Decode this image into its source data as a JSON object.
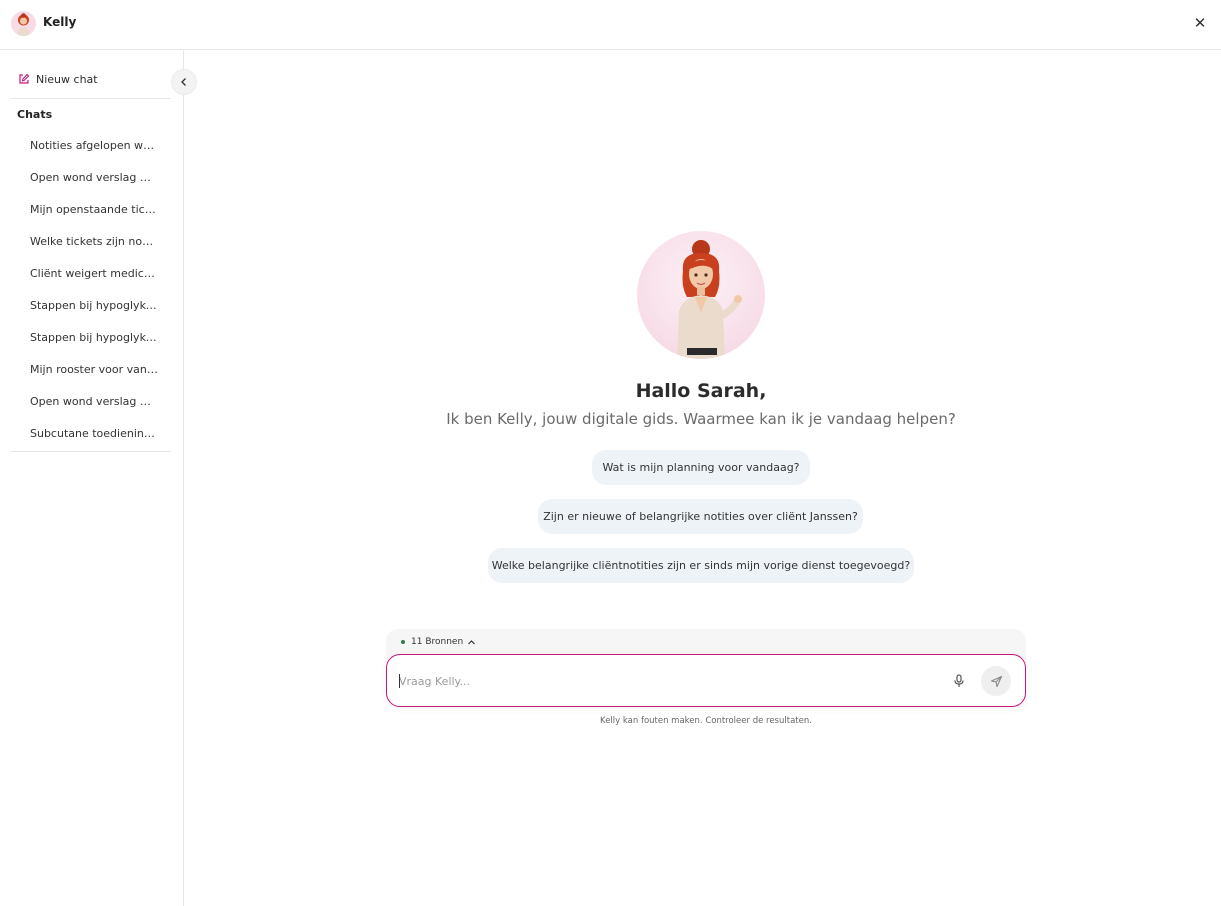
{
  "header": {
    "title": "Kelly",
    "close_glyph": "✕"
  },
  "sidebar": {
    "new_chat_label": "Nieuw chat",
    "chats_heading": "Chats",
    "chats": [
      "Notities afgelopen weekend",
      "Open wond verslag Mevrouw",
      "Mijn openstaande tickets",
      "Welke tickets zijn nog open",
      "Cliënt weigert medicatie",
      "Stappen bij hypoglykemie",
      "Stappen bij hypoglykemie",
      "Mijn rooster voor vandaag",
      "Open wond verslag Mevrouw",
      "Subcutane toediening insuline"
    ]
  },
  "main": {
    "greeting": "Hallo Sarah,",
    "subtitle": "Ik ben Kelly, jouw digitale gids. Waarmee kan ik je vandaag helpen?",
    "suggestions": [
      "Wat is mijn planning voor vandaag?",
      "Zijn er nieuwe of belangrijke notities over cliënt Janssen?",
      "Welke belangrijke cliëntnotities zijn er sinds mijn vorige dienst toegevoegd?"
    ],
    "sources_label": "11 Bronnen",
    "input_placeholder": "Vraag Kelly...",
    "disclaimer": "Kelly kan fouten maken. Controleer de resultaten."
  },
  "colors": {
    "accent": "#c4197a",
    "suggestion_bg": "#eef3f8",
    "avatar_bg": "#f7dde8",
    "status_dot": "#2e7d4f"
  },
  "icons": {
    "new_chat": "edit-icon",
    "collapse": "chevron-left-icon",
    "close": "close-icon",
    "sources_toggle": "chevron-up-icon",
    "mic": "microphone-icon",
    "send": "send-icon"
  }
}
